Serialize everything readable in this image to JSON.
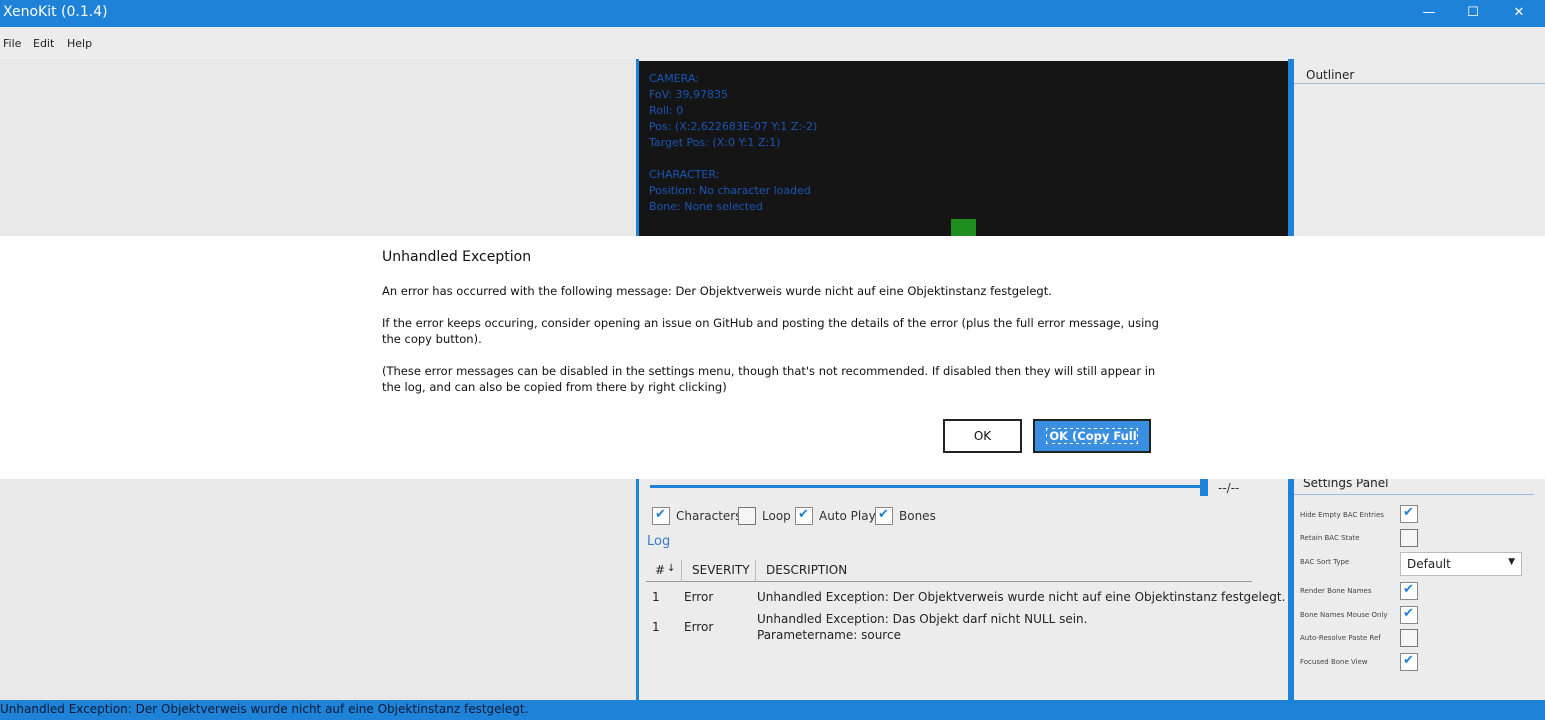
{
  "window": {
    "title": "XenoKit (0.1.4)",
    "min_icon": "minimize-icon",
    "max_icon": "maximize-icon",
    "close_icon": "close-icon"
  },
  "menu": {
    "items": [
      "File",
      "Edit",
      "Help"
    ]
  },
  "viewport": {
    "lines": [
      "CAMERA:",
      "FoV: 39,97835",
      "Roll: 0",
      "Pos: (X:2,622683E-07 Y:1 Z:-2)",
      "Target Pos: (X:0 Y:1 Z:1)",
      "",
      "CHARACTER:",
      "Position: No character loaded",
      "Bone: None selected"
    ]
  },
  "outliner": {
    "title": "Outliner"
  },
  "playback": {
    "timecode": "--/--",
    "options": [
      {
        "label": "Characters",
        "checked": true
      },
      {
        "label": "Loop",
        "checked": false
      },
      {
        "label": "Auto Play",
        "checked": true
      },
      {
        "label": "Bones",
        "checked": true
      }
    ]
  },
  "log": {
    "title": "Log",
    "columns": [
      "#",
      "SEVERITY",
      "DESCRIPTION"
    ],
    "rows": [
      {
        "num": "1",
        "severity": "Error",
        "description": "Unhandled Exception: Der Objektverweis wurde nicht auf eine Objektinstanz festgelegt."
      },
      {
        "num": "1",
        "severity": "Error",
        "description": "Unhandled Exception: Das Objekt darf nicht NULL sein.",
        "description2": "Parametername: source"
      }
    ]
  },
  "settings": {
    "title": "Settings Panel",
    "items": [
      {
        "label": "Hide Empty BAC Entries",
        "checked": true
      },
      {
        "label": "Retain BAC State",
        "checked": false
      },
      {
        "label": "BAC Sort Type",
        "select": "Default"
      },
      {
        "label": "Render Bone Names",
        "checked": true
      },
      {
        "label": "Bone Names Mouse Only",
        "checked": true
      },
      {
        "label": "Auto-Resolve Paste Ref",
        "checked": false
      },
      {
        "label": "Focused Bone View",
        "checked": true
      }
    ]
  },
  "status": {
    "text": "Unhandled Exception: Der Objektverweis wurde nicht auf eine Objektinstanz festgelegt."
  },
  "dialog": {
    "title": "Unhandled Exception",
    "message1": "An error has occurred with the following message: Der Objektverweis wurde nicht auf eine Objektinstanz festgelegt.",
    "message2": "If the error keeps occuring, consider opening an issue on GitHub and posting the details of the error (plus the full error message, using the copy button).",
    "message3": "(These error messages can be disabled in the settings menu, though that's not recommended. If disabled then they will still appear in the log, and can also be copied from there by right clicking)",
    "ok_label": "OK",
    "copy_label": "OK (Copy Full Error)"
  }
}
